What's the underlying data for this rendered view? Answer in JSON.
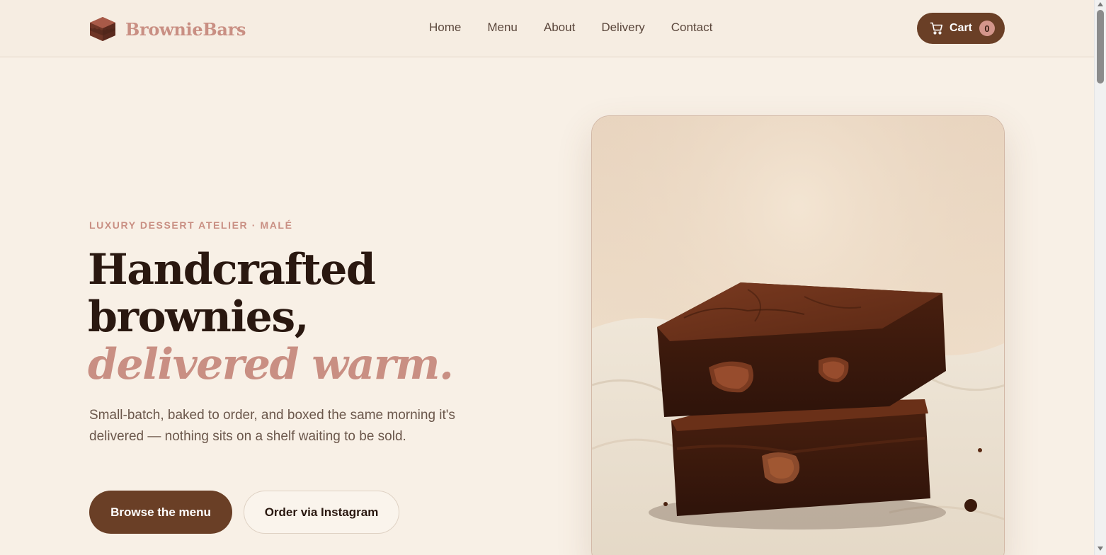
{
  "header": {
    "brand": "BrownieBars",
    "logo_icon": "brownie-logo-icon",
    "nav": [
      {
        "label": "Home"
      },
      {
        "label": "Menu"
      },
      {
        "label": "About"
      },
      {
        "label": "Delivery"
      },
      {
        "label": "Contact"
      }
    ],
    "cart": {
      "label": "Cart",
      "count": "0",
      "icon": "cart-icon"
    }
  },
  "hero": {
    "eyebrow": "LUXURY DESSERT ATELIER · MALÉ",
    "headline_line1": "Handcrafted",
    "headline_line2": "brownies,",
    "headline_accent": "delivered warm.",
    "lede": "Small-batch, baked to order, and boxed the same morning it's delivered — nothing sits on a shelf waiting to be sold.",
    "primary_cta": "Browse the menu",
    "secondary_cta": "Order via Instagram"
  },
  "colors": {
    "background": "#f8f0e6",
    "brand_brown": "#6a3f26",
    "accent_pink": "#c98f83",
    "heading": "#2a1810",
    "body_text": "#6b574b"
  }
}
